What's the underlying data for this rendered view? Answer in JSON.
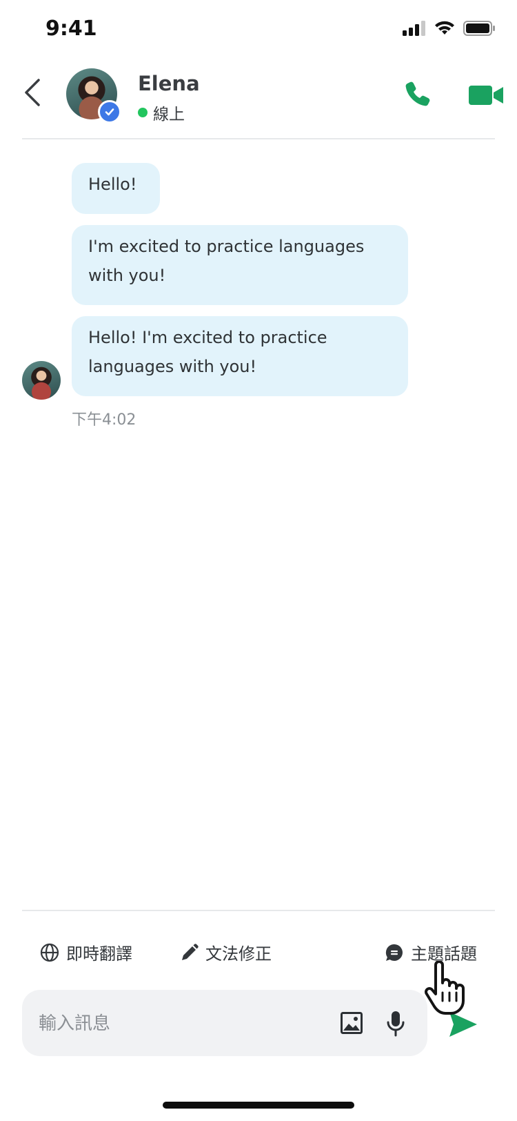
{
  "status_bar": {
    "time": "9:41"
  },
  "header": {
    "contact_name": "Elena",
    "presence": "線上",
    "colors": {
      "accent_green": "#1aa260",
      "online": "#22c55e",
      "verified": "#3d78e6"
    },
    "icons": [
      "back-icon",
      "phone-icon",
      "video-icon",
      "verified-icon"
    ]
  },
  "messages": [
    {
      "text": "Hello!"
    },
    {
      "text_lines": [
        "I'm excited to practice languages",
        "with you!"
      ]
    },
    {
      "text_lines": [
        "Hello! I'm excited to practice",
        "languages with you!"
      ]
    }
  ],
  "timestamp": "下午4:02",
  "toolbar": {
    "translate_label": "即時翻譯",
    "grammar_label": "文法修正",
    "topic_label": "主題話題"
  },
  "composer": {
    "placeholder": "輸入訊息",
    "bubble_color": "#e2f3fb"
  }
}
